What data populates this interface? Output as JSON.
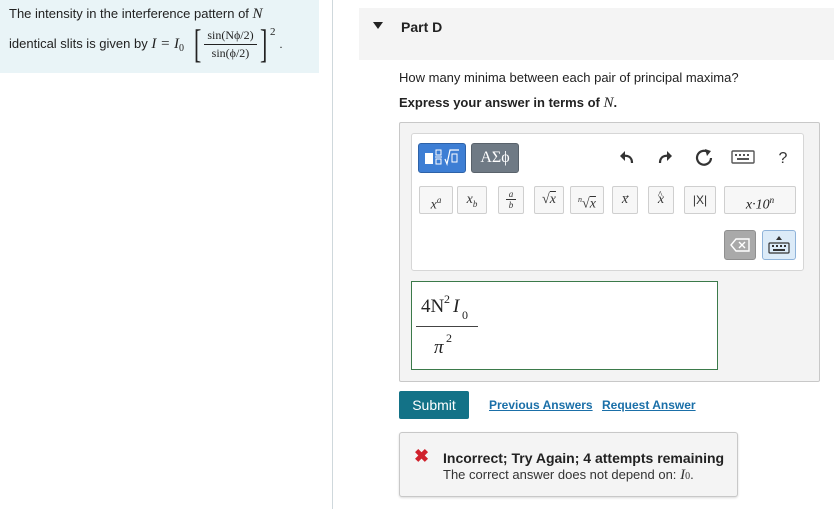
{
  "intro": {
    "line1_text": "The intensity in the interference pattern of",
    "line1_var": "N",
    "line2_text": "identical slits is given by",
    "formula_lhs": "I = I",
    "formula_sub": "0",
    "formula_num": "sin(Nϕ/2)",
    "formula_den": "sin(ϕ/2)",
    "formula_exp": "2",
    "formula_end": "."
  },
  "part": {
    "toggle_icon": "caret-down-icon",
    "title": "Part D"
  },
  "question": {
    "text": "How many minima between each pair of principal maxima?",
    "instruction_text": "Express your answer in terms of",
    "instruction_var": "N",
    "instruction_end": "."
  },
  "toolbar": {
    "mode_templates_icon": "templates-icon",
    "mode_greek_label": "ΑΣϕ",
    "undo_icon": "undo-icon",
    "redo_icon": "redo-icon",
    "reset_icon": "reset-icon",
    "keyboard_icon": "keyboard-icon",
    "help_label": "?",
    "delete_icon": "delete-icon",
    "show_keyboard_icon": "show-keyboard-icon",
    "scientific_label": "x·10",
    "scientific_exp": "n",
    "abs_label": "|X|"
  },
  "answer": {
    "num_coef": "4N",
    "num_exp": "2",
    "num_var": "I",
    "num_sub": "0",
    "den_var": "π",
    "den_exp": "2"
  },
  "actions": {
    "submit_label": "Submit",
    "previous_answers_label": "Previous Answers",
    "request_answer_label": "Request Answer"
  },
  "feedback": {
    "icon": "x-mark-icon",
    "title": "Incorrect; Try Again; 4 attempts remaining",
    "detail_text": "The correct answer does not depend on:",
    "detail_var": "I",
    "detail_sub": "0",
    "detail_end": "."
  },
  "colors": {
    "intro_bg": "#e9f4f7",
    "submit_bg": "#137287",
    "link": "#1a6fa8",
    "error": "#d0212c",
    "mode_active": "#3d7ed4"
  }
}
